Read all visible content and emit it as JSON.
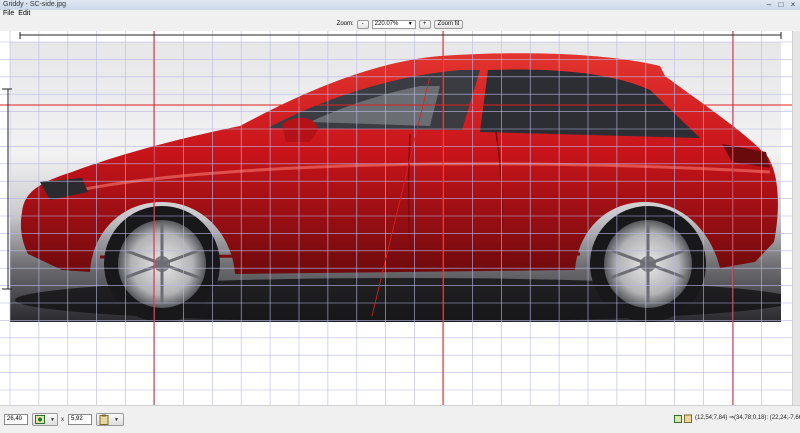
{
  "window": {
    "title": "Griddy - SC-side.jpg"
  },
  "menu": {
    "items": [
      "File",
      "Edit"
    ]
  },
  "toolbar": {
    "zoom_label": "Zoom:",
    "zoom_out_label": "-",
    "zoom_value": "220.07%",
    "zoom_in_label": "+",
    "zoom_fit_label": "Zoom fit"
  },
  "status": {
    "width_value": "26,40",
    "times_label": "x",
    "height_value": "5,92",
    "readout": "(12,54;7,84) ⇒(34,78;0,18): (22,24;-7,66)"
  },
  "colors": {
    "guide": "#e02020",
    "grid": "#b8b8e6",
    "car": "#c8141a"
  },
  "icons": [
    "color-picker-icon",
    "clipboard-icon",
    "minimize-icon",
    "maximize-icon",
    "close-icon"
  ]
}
